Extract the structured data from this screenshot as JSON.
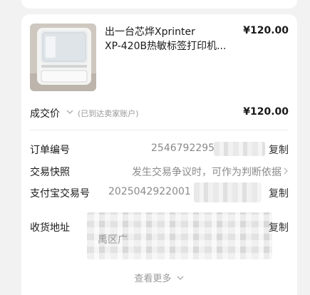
{
  "product": {
    "title_line1": "出一台芯烨Xprinter",
    "title_line2": "XP-420B热敏标签打印机...",
    "price": "¥120.00"
  },
  "deal": {
    "label": "成交价",
    "note": "(已到达卖家账户)",
    "price": "¥120.00"
  },
  "order_no": {
    "label": "订单编号",
    "value": "2546792295",
    "copy_label": "复制"
  },
  "snapshot": {
    "label": "交易快照",
    "value": "发生交易争议时，可作为判断依据"
  },
  "alipay": {
    "label": "支付宝交易号",
    "value": "2025042922001",
    "copy_label": "复制"
  },
  "address": {
    "label": "收货地址",
    "value_fragment": "禹区广",
    "copy_label": "复制"
  },
  "more": {
    "label": "查看更多"
  },
  "colors": {
    "background": "#f2f2f2",
    "card": "#ffffff",
    "muted_text": "#8a8a8a"
  }
}
